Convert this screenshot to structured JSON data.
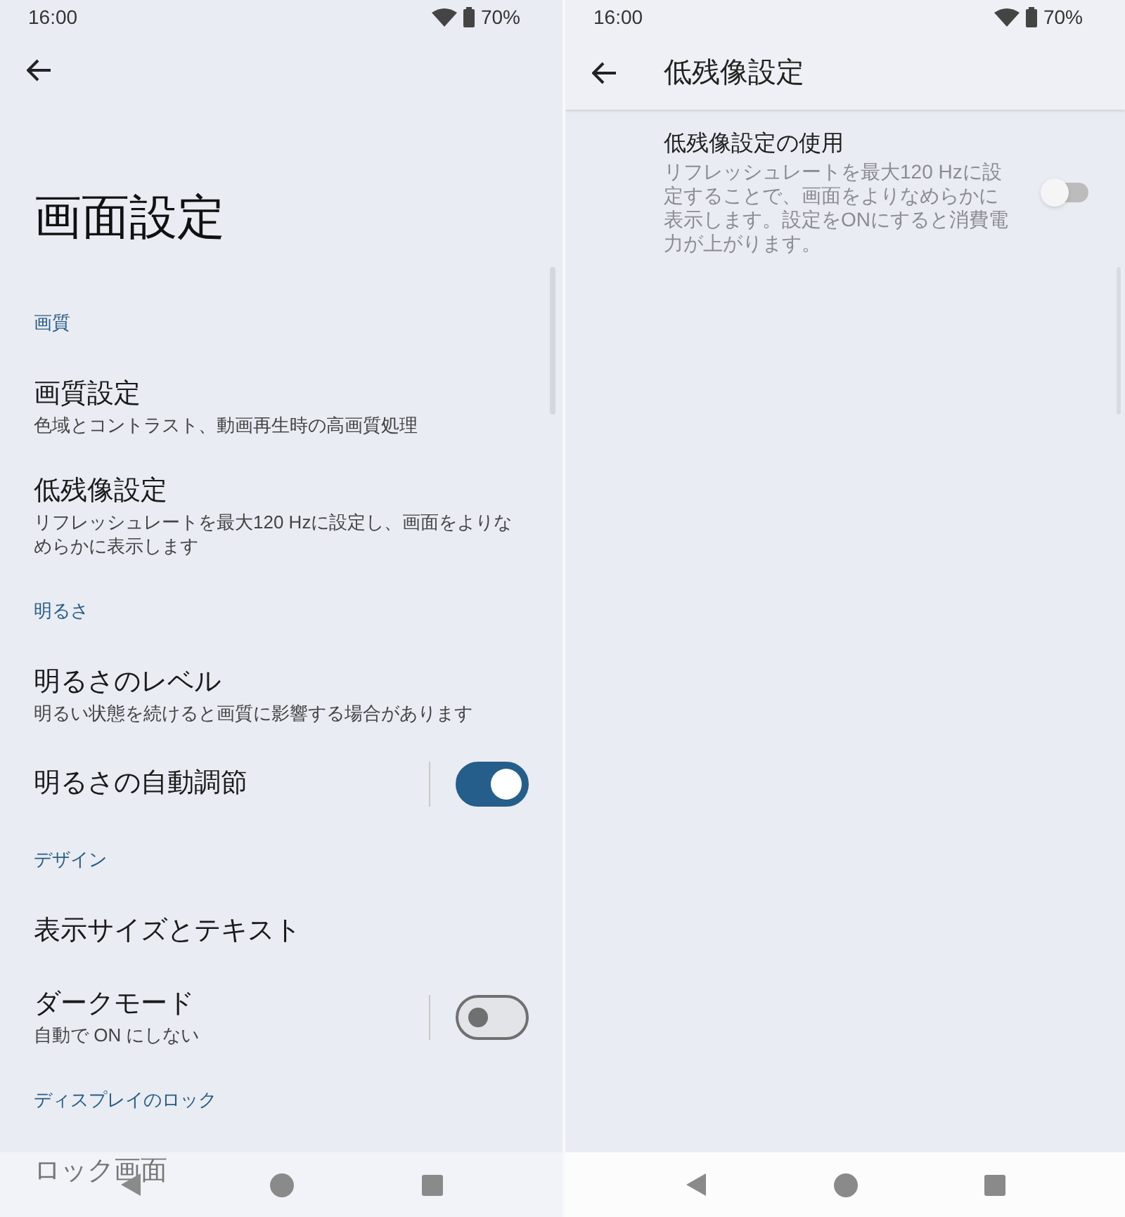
{
  "left_screen": {
    "status_bar": {
      "time": "16:00",
      "battery": "70%"
    },
    "title": "画面設定",
    "items": [
      {
        "kind": "header",
        "title": "画質"
      },
      {
        "kind": "item",
        "title": "画質設定",
        "summary": "色域とコントラスト、動画再生時の高画質処理"
      },
      {
        "kind": "item",
        "title": "低残像設定",
        "summary": "リフレッシュレートを最大120 Hzに設定し、画面をよりなめらかに表示します"
      },
      {
        "kind": "header",
        "title": "明るさ"
      },
      {
        "kind": "item",
        "title": "明るさのレベル",
        "summary": "明るい状態を続けると画質に影響する場合があります"
      },
      {
        "kind": "switch",
        "title": "明るさの自動調節",
        "on": true
      },
      {
        "kind": "header",
        "title": "デザイン"
      },
      {
        "kind": "item",
        "title": "表示サイズとテキスト"
      },
      {
        "kind": "switch",
        "title": "ダークモード",
        "summary": "自動で ON にしない",
        "on": false
      },
      {
        "kind": "header",
        "title": "ディスプレイのロック"
      },
      {
        "kind": "item",
        "title": "ロック画面"
      }
    ]
  },
  "right_screen": {
    "status_bar": {
      "time": "16:00",
      "battery": "70%"
    },
    "title": "低残像設定",
    "items": [
      {
        "kind": "plain_switch",
        "title": "低残像設定の使用",
        "summary": "リフレッシュレートを最大120 Hzに設定することで、画面をよりなめらかに表示します。設定をONにすると消費電力が上がります。",
        "on": false
      }
    ]
  }
}
